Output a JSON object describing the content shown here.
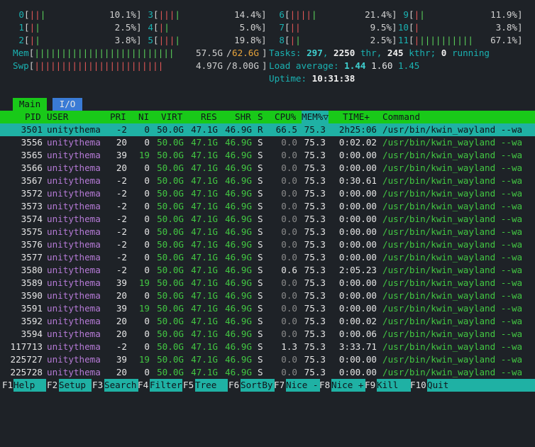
{
  "cpu": [
    {
      "id": "0",
      "pct": "10.1%",
      "bars": [
        {
          "c": "red",
          "n": "||"
        },
        {
          "c": "green",
          "n": "|"
        }
      ]
    },
    {
      "id": "1",
      "pct": "2.5%",
      "bars": [
        {
          "c": "red",
          "n": "|"
        },
        {
          "c": "green",
          "n": "|"
        }
      ]
    },
    {
      "id": "2",
      "pct": "3.8%",
      "bars": [
        {
          "c": "red",
          "n": "|"
        },
        {
          "c": "green",
          "n": "|"
        }
      ]
    },
    {
      "id": "3",
      "pct": "14.4%",
      "bars": [
        {
          "c": "red",
          "n": "|||"
        },
        {
          "c": "green",
          "n": "|"
        }
      ]
    },
    {
      "id": "4",
      "pct": "5.0%",
      "bars": [
        {
          "c": "red",
          "n": "|"
        },
        {
          "c": "green",
          "n": "|"
        }
      ]
    },
    {
      "id": "5",
      "pct": "19.8%",
      "bars": [
        {
          "c": "red",
          "n": "|||"
        },
        {
          "c": "green",
          "n": "|"
        }
      ]
    },
    {
      "id": "6",
      "pct": "21.4%",
      "bars": [
        {
          "c": "red",
          "n": "||||"
        },
        {
          "c": "green",
          "n": "|"
        }
      ]
    },
    {
      "id": "7",
      "pct": "9.5%",
      "bars": [
        {
          "c": "red",
          "n": "||"
        },
        {
          "c": "green",
          "n": ""
        }
      ]
    },
    {
      "id": "8",
      "pct": "2.5%",
      "bars": [
        {
          "c": "red",
          "n": "|"
        },
        {
          "c": "green",
          "n": "|"
        }
      ]
    },
    {
      "id": "9",
      "pct": "11.9%",
      "bars": [
        {
          "c": "red",
          "n": "|"
        },
        {
          "c": "green",
          "n": "|"
        }
      ]
    },
    {
      "id": "10",
      "pct": "3.8%",
      "bars": [
        {
          "c": "red",
          "n": "|"
        },
        {
          "c": "green",
          "n": ""
        }
      ]
    },
    {
      "id": "11",
      "pct": "67.1%",
      "bars": [
        {
          "c": "red",
          "n": "|"
        },
        {
          "c": "green",
          "n": "||||||||||"
        }
      ]
    }
  ],
  "mem": {
    "label": "Mem",
    "bars": "||||||||||||||||||||||||||",
    "used": "57.5G",
    "total": "62.6G"
  },
  "swp": {
    "label": "Swp",
    "bars": "||||||||||||||||||||||||",
    "used": "4.97G",
    "total": "8.00G"
  },
  "tasks": {
    "label": "Tasks:",
    "tasks": "297",
    "thr": "2250",
    "thr_label": "thr,",
    "kthr": "245",
    "kthr_label": "kthr;",
    "running": "0",
    "running_label": "running"
  },
  "load": {
    "label": "Load average:",
    "l1": "1.44",
    "l5": "1.60",
    "l15": "1.45"
  },
  "uptime": {
    "label": "Uptime:",
    "value": "10:31:38"
  },
  "tabs": {
    "main": "Main",
    "io": "I/O"
  },
  "columns": {
    "pid": "PID",
    "user": "USER",
    "pri": "PRI",
    "ni": "NI",
    "virt": "VIRT",
    "res": "RES",
    "shr": "SHR",
    "s": "S",
    "cpu": "CPU%",
    "mem": "MEM%▽",
    "time": "TIME+",
    "cmd": "Command"
  },
  "processes": [
    {
      "pid": "3501",
      "user": "unitythema",
      "pri": "-2",
      "ni": "0",
      "virt": "50.0G",
      "res": "47.1G",
      "shr": "46.9G",
      "s": "R",
      "cpu": "66.5",
      "mem": "75.3",
      "time": "2h25:06",
      "cmd": "/usr/bin/kwin_wayland --wa"
    },
    {
      "pid": "3556",
      "user": "unitythema",
      "pri": "20",
      "ni": "0",
      "virt": "50.0G",
      "res": "47.1G",
      "shr": "46.9G",
      "s": "S",
      "cpu": "0.0",
      "mem": "75.3",
      "time": "0:02.02",
      "cmd": "/usr/bin/kwin_wayland --wa"
    },
    {
      "pid": "3565",
      "user": "unitythema",
      "pri": "39",
      "ni": "19",
      "virt": "50.0G",
      "res": "47.1G",
      "shr": "46.9G",
      "s": "S",
      "cpu": "0.0",
      "mem": "75.3",
      "time": "0:00.00",
      "cmd": "/usr/bin/kwin_wayland --wa"
    },
    {
      "pid": "3566",
      "user": "unitythema",
      "pri": "20",
      "ni": "0",
      "virt": "50.0G",
      "res": "47.1G",
      "shr": "46.9G",
      "s": "S",
      "cpu": "0.0",
      "mem": "75.3",
      "time": "0:00.00",
      "cmd": "/usr/bin/kwin_wayland --wa"
    },
    {
      "pid": "3567",
      "user": "unitythema",
      "pri": "-2",
      "ni": "0",
      "virt": "50.0G",
      "res": "47.1G",
      "shr": "46.9G",
      "s": "S",
      "cpu": "0.0",
      "mem": "75.3",
      "time": "0:30.61",
      "cmd": "/usr/bin/kwin_wayland --wa"
    },
    {
      "pid": "3572",
      "user": "unitythema",
      "pri": "-2",
      "ni": "0",
      "virt": "50.0G",
      "res": "47.1G",
      "shr": "46.9G",
      "s": "S",
      "cpu": "0.0",
      "mem": "75.3",
      "time": "0:00.00",
      "cmd": "/usr/bin/kwin_wayland --wa"
    },
    {
      "pid": "3573",
      "user": "unitythema",
      "pri": "-2",
      "ni": "0",
      "virt": "50.0G",
      "res": "47.1G",
      "shr": "46.9G",
      "s": "S",
      "cpu": "0.0",
      "mem": "75.3",
      "time": "0:00.00",
      "cmd": "/usr/bin/kwin_wayland --wa"
    },
    {
      "pid": "3574",
      "user": "unitythema",
      "pri": "-2",
      "ni": "0",
      "virt": "50.0G",
      "res": "47.1G",
      "shr": "46.9G",
      "s": "S",
      "cpu": "0.0",
      "mem": "75.3",
      "time": "0:00.00",
      "cmd": "/usr/bin/kwin_wayland --wa"
    },
    {
      "pid": "3575",
      "user": "unitythema",
      "pri": "-2",
      "ni": "0",
      "virt": "50.0G",
      "res": "47.1G",
      "shr": "46.9G",
      "s": "S",
      "cpu": "0.0",
      "mem": "75.3",
      "time": "0:00.00",
      "cmd": "/usr/bin/kwin_wayland --wa"
    },
    {
      "pid": "3576",
      "user": "unitythema",
      "pri": "-2",
      "ni": "0",
      "virt": "50.0G",
      "res": "47.1G",
      "shr": "46.9G",
      "s": "S",
      "cpu": "0.0",
      "mem": "75.3",
      "time": "0:00.00",
      "cmd": "/usr/bin/kwin_wayland --wa"
    },
    {
      "pid": "3577",
      "user": "unitythema",
      "pri": "-2",
      "ni": "0",
      "virt": "50.0G",
      "res": "47.1G",
      "shr": "46.9G",
      "s": "S",
      "cpu": "0.0",
      "mem": "75.3",
      "time": "0:00.00",
      "cmd": "/usr/bin/kwin_wayland --wa"
    },
    {
      "pid": "3580",
      "user": "unitythema",
      "pri": "-2",
      "ni": "0",
      "virt": "50.0G",
      "res": "47.1G",
      "shr": "46.9G",
      "s": "S",
      "cpu": "0.6",
      "mem": "75.3",
      "time": "2:05.23",
      "cmd": "/usr/bin/kwin_wayland --wa"
    },
    {
      "pid": "3589",
      "user": "unitythema",
      "pri": "39",
      "ni": "19",
      "virt": "50.0G",
      "res": "47.1G",
      "shr": "46.9G",
      "s": "S",
      "cpu": "0.0",
      "mem": "75.3",
      "time": "0:00.00",
      "cmd": "/usr/bin/kwin_wayland --wa"
    },
    {
      "pid": "3590",
      "user": "unitythema",
      "pri": "20",
      "ni": "0",
      "virt": "50.0G",
      "res": "47.1G",
      "shr": "46.9G",
      "s": "S",
      "cpu": "0.0",
      "mem": "75.3",
      "time": "0:00.00",
      "cmd": "/usr/bin/kwin_wayland --wa"
    },
    {
      "pid": "3591",
      "user": "unitythema",
      "pri": "39",
      "ni": "19",
      "virt": "50.0G",
      "res": "47.1G",
      "shr": "46.9G",
      "s": "S",
      "cpu": "0.0",
      "mem": "75.3",
      "time": "0:00.00",
      "cmd": "/usr/bin/kwin_wayland --wa"
    },
    {
      "pid": "3592",
      "user": "unitythema",
      "pri": "20",
      "ni": "0",
      "virt": "50.0G",
      "res": "47.1G",
      "shr": "46.9G",
      "s": "S",
      "cpu": "0.0",
      "mem": "75.3",
      "time": "0:00.02",
      "cmd": "/usr/bin/kwin_wayland --wa"
    },
    {
      "pid": "3594",
      "user": "unitythema",
      "pri": "20",
      "ni": "0",
      "virt": "50.0G",
      "res": "47.1G",
      "shr": "46.9G",
      "s": "S",
      "cpu": "0.0",
      "mem": "75.3",
      "time": "0:00.06",
      "cmd": "/usr/bin/kwin_wayland --wa"
    },
    {
      "pid": "117713",
      "user": "unitythema",
      "pri": "-2",
      "ni": "0",
      "virt": "50.0G",
      "res": "47.1G",
      "shr": "46.9G",
      "s": "S",
      "cpu": "1.3",
      "mem": "75.3",
      "time": "3:33.71",
      "cmd": "/usr/bin/kwin_wayland --wa"
    },
    {
      "pid": "225727",
      "user": "unitythema",
      "pri": "39",
      "ni": "19",
      "virt": "50.0G",
      "res": "47.1G",
      "shr": "46.9G",
      "s": "S",
      "cpu": "0.0",
      "mem": "75.3",
      "time": "0:00.00",
      "cmd": "/usr/bin/kwin_wayland --wa"
    },
    {
      "pid": "225728",
      "user": "unitythema",
      "pri": "20",
      "ni": "0",
      "virt": "50.0G",
      "res": "47.1G",
      "shr": "46.9G",
      "s": "S",
      "cpu": "0.0",
      "mem": "75.3",
      "time": "0:00.00",
      "cmd": "/usr/bin/kwin_wayland --wa"
    }
  ],
  "fkeys": [
    {
      "key": "F1",
      "label": "Help"
    },
    {
      "key": "F2",
      "label": "Setup"
    },
    {
      "key": "F3",
      "label": "Search"
    },
    {
      "key": "F4",
      "label": "Filter"
    },
    {
      "key": "F5",
      "label": "Tree"
    },
    {
      "key": "F6",
      "label": "SortBy"
    },
    {
      "key": "F7",
      "label": "Nice -"
    },
    {
      "key": "F8",
      "label": "Nice +"
    },
    {
      "key": "F9",
      "label": "Kill"
    },
    {
      "key": "F10",
      "label": "Quit"
    }
  ]
}
